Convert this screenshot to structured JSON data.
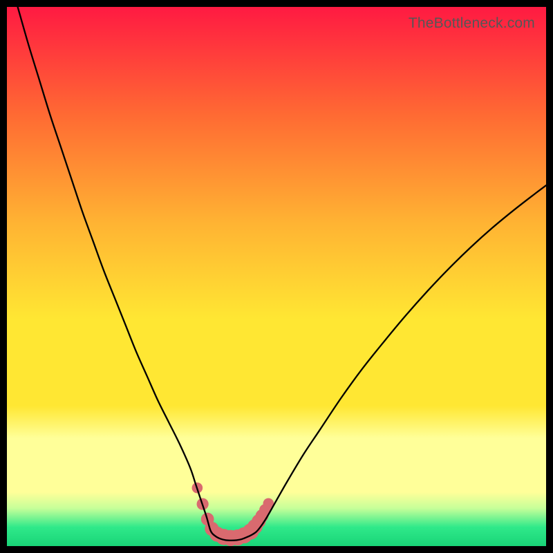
{
  "watermark": "TheBottleneck.com",
  "colors": {
    "top": "#ff1a42",
    "mid_a": "#ff6a33",
    "mid_b": "#ffb333",
    "yellow": "#ffe733",
    "pale_yellow": "#ffff99",
    "pale_green": "#c6ff99",
    "green": "#2fe98a",
    "green_bottom": "#19d477",
    "curve": "#000000",
    "marker": "#d96a6f"
  },
  "gradient_stops": [
    {
      "offset": 0.0,
      "key": "top"
    },
    {
      "offset": 0.2,
      "key": "mid_a"
    },
    {
      "offset": 0.4,
      "key": "mid_b"
    },
    {
      "offset": 0.58,
      "key": "yellow"
    },
    {
      "offset": 0.74,
      "key": "yellow"
    },
    {
      "offset": 0.8,
      "key": "pale_yellow"
    },
    {
      "offset": 0.9,
      "key": "pale_yellow"
    },
    {
      "offset": 0.93,
      "key": "pale_green"
    },
    {
      "offset": 0.965,
      "key": "green"
    },
    {
      "offset": 1.0,
      "key": "green_bottom"
    }
  ],
  "chart_data": {
    "type": "line",
    "title": "",
    "xlabel": "",
    "ylabel": "",
    "xlim": [
      0,
      100
    ],
    "ylim": [
      0,
      100
    ],
    "series": [
      {
        "name": "bottleneck-curve-left",
        "x": [
          2,
          4,
          6,
          8,
          10,
          12,
          14,
          16,
          18,
          20,
          22,
          24,
          26,
          28,
          30,
          32,
          34,
          35,
          36,
          37,
          37.8
        ],
        "y": [
          100,
          93,
          86.5,
          80,
          74,
          68,
          62,
          56.5,
          51,
          46,
          41,
          36,
          31.5,
          27,
          23,
          19,
          14.5,
          11.5,
          8.5,
          5.5,
          2.8
        ]
      },
      {
        "name": "bottleneck-trough",
        "x": [
          37.8,
          38.6,
          39.6,
          40.6,
          41.6,
          42.6,
          43.6,
          44.6,
          45.6,
          46.5
        ],
        "y": [
          2.8,
          1.9,
          1.35,
          1.1,
          1.05,
          1.1,
          1.3,
          1.7,
          2.2,
          2.9
        ]
      },
      {
        "name": "bottleneck-curve-right",
        "x": [
          46.5,
          48,
          50,
          52,
          55,
          58,
          62,
          66,
          70,
          74,
          78,
          82,
          86,
          90,
          94,
          98,
          100
        ],
        "y": [
          2.9,
          5.0,
          8.5,
          12,
          17,
          21.5,
          27.5,
          33,
          38,
          42.8,
          47.3,
          51.5,
          55.4,
          59.0,
          62.3,
          65.4,
          66.9
        ]
      }
    ],
    "markers": {
      "name": "trough-markers",
      "points": [
        {
          "x": 35.3,
          "y": 10.8,
          "r": 1.0
        },
        {
          "x": 36.3,
          "y": 7.8,
          "r": 1.1
        },
        {
          "x": 37.2,
          "y": 5.0,
          "r": 1.2
        },
        {
          "x": 38.0,
          "y": 3.2,
          "r": 1.3
        },
        {
          "x": 39.0,
          "y": 2.2,
          "r": 1.4
        },
        {
          "x": 40.2,
          "y": 1.7,
          "r": 1.5
        },
        {
          "x": 41.5,
          "y": 1.5,
          "r": 1.5
        },
        {
          "x": 42.8,
          "y": 1.6,
          "r": 1.5
        },
        {
          "x": 44.0,
          "y": 2.0,
          "r": 1.5
        },
        {
          "x": 45.2,
          "y": 2.7,
          "r": 1.5
        },
        {
          "x": 46.0,
          "y": 3.6,
          "r": 1.4
        },
        {
          "x": 46.7,
          "y": 4.6,
          "r": 1.3
        },
        {
          "x": 47.3,
          "y": 5.6,
          "r": 1.2
        },
        {
          "x": 47.9,
          "y": 6.7,
          "r": 1.1
        },
        {
          "x": 48.5,
          "y": 7.9,
          "r": 1.0
        }
      ]
    }
  }
}
